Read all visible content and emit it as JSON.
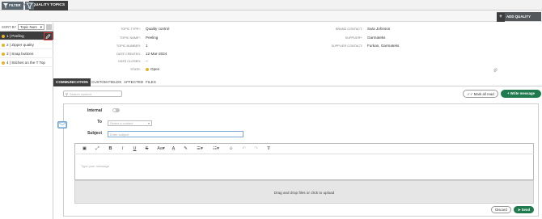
{
  "top_tabs": [
    "CERTIFICATES",
    "QUALITY TOPICS"
  ],
  "filter": {
    "label": "FILTER"
  },
  "add_button": {
    "label": "ADD QUALITY TOPIC",
    "icon": "plus-icon"
  },
  "sidebar": {
    "sort_label": "SORT BY",
    "sort_value": "Topic Num",
    "items": [
      {
        "label": "1 | Peeling"
      },
      {
        "label": "2 | Zipper quality"
      },
      {
        "label": "3 | Snap buttons"
      },
      {
        "label": "4 | Stiches on the T Top"
      }
    ]
  },
  "details": {
    "left": [
      {
        "label": "TOPIC TYPE*:",
        "value": "Quality control"
      },
      {
        "label": "TOPIC NAME*:",
        "value": "Peeling"
      },
      {
        "label": "TOPIC NUMBER:",
        "value": "1"
      },
      {
        "label": "DATE CREATED:",
        "value": "12-Mar-2024"
      },
      {
        "label": "DATE CLOSED:",
        "value": "--"
      },
      {
        "label": "STATE:",
        "value": "Open"
      }
    ],
    "right": [
      {
        "label": "BRAND CONTACT:",
        "value": "Sara Johnson"
      },
      {
        "label": "SUPPLIER*:",
        "value": "Garmateks"
      },
      {
        "label": "SUPPLIER CONTACT:",
        "value": "Furkan, Garmateks"
      }
    ]
  },
  "tabs": [
    "COMMUNICATION",
    "CUSTOM FIELDS",
    "AFFECTED",
    "FILES"
  ],
  "search": {
    "placeholder": "Search content"
  },
  "mark_all_read": "Mark all read",
  "write_message": "Write message",
  "composer": {
    "internal_label": "Internal",
    "to_label": "To",
    "to_placeholder": "Select a contact",
    "subject_label": "Subject",
    "subject_placeholder": "Enter subject",
    "message_placeholder": "Type your message",
    "dropzone": "Drag and drop files or click to upload",
    "discard": "Discard",
    "send": "Send"
  },
  "colors": {
    "accent": "#1f7a4d",
    "state_open": "#e3b32a",
    "dark": "#3c3c3c"
  }
}
